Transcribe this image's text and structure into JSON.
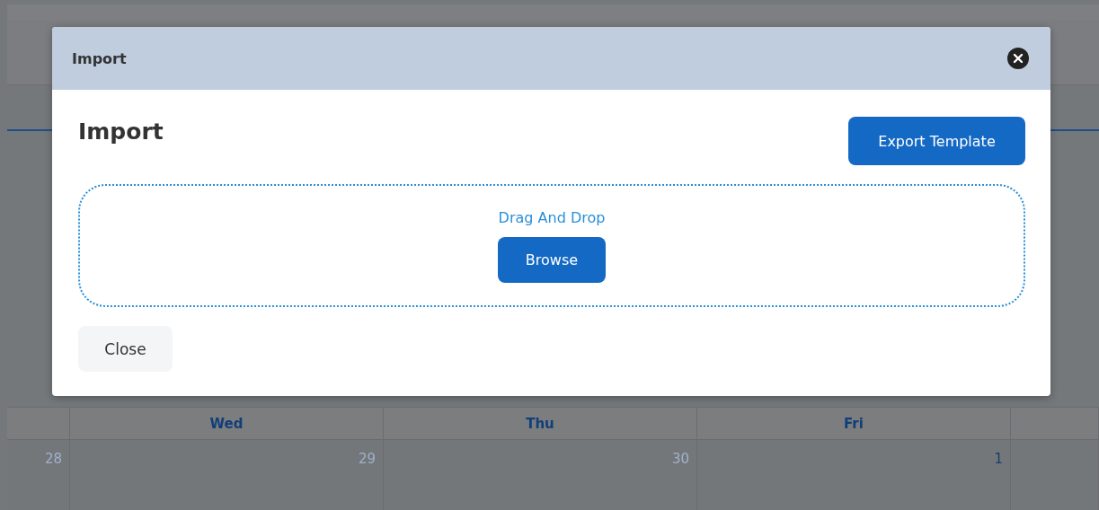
{
  "calendar": {
    "headers": [
      {
        "label": "Wed"
      },
      {
        "label": "Thu"
      },
      {
        "label": "Fri"
      }
    ],
    "days": [
      {
        "day": "28",
        "other_month": true
      },
      {
        "day": "29",
        "other_month": true
      },
      {
        "day": "30",
        "other_month": true
      },
      {
        "day": "1",
        "other_month": false
      }
    ]
  },
  "dialog": {
    "title": "Import",
    "heading": "Import",
    "export_button": "Export Template",
    "dropzone": {
      "text": "Drag And Drop",
      "browse_button": "Browse"
    },
    "close_button": "Close"
  }
}
